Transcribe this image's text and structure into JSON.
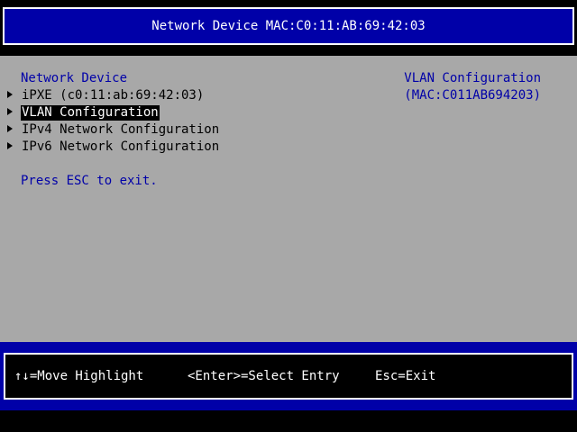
{
  "window": {
    "title": "Network Device MAC:C0:11:AB:69:42:03"
  },
  "main": {
    "section_heading": "Network Device",
    "items": [
      {
        "label": "iPXE (c0:11:ab:69:42:03)",
        "selected": false
      },
      {
        "label": "VLAN Configuration",
        "selected": true
      },
      {
        "label": "IPv4 Network Configuration",
        "selected": false
      },
      {
        "label": "IPv6 Network Configuration",
        "selected": false
      }
    ],
    "exit_note": "Press ESC to exit."
  },
  "help_panel": {
    "title": "VLAN Configuration",
    "detail": "(MAC:C011AB694203)"
  },
  "footer": {
    "move": "↑↓=Move Highlight",
    "select": "<Enter>=Select Entry",
    "exit": "Esc=Exit"
  },
  "colors": {
    "background_gray": "#a8a8a8",
    "bios_blue": "#0000a8",
    "highlight_bg": "#000000",
    "text_white": "#ffffff"
  },
  "icons": {
    "menu_item_marker": "triangle-right-icon"
  }
}
